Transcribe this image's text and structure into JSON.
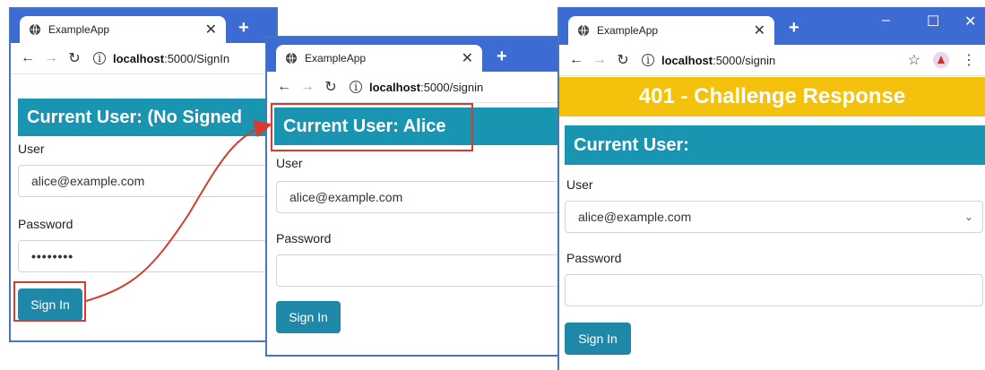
{
  "windows": [
    {
      "tab_title": "ExampleApp",
      "url_host": "localhost",
      "url_rest": ":5000/SignIn",
      "header": "Current User: (No Signed",
      "user_label": "User",
      "user_value": "alice@example.com",
      "password_label": "Password",
      "password_value": "••••••••",
      "sign_in": "Sign In"
    },
    {
      "tab_title": "ExampleApp",
      "url_host": "localhost",
      "url_rest": ":5000/signin",
      "header": "Current User: Alice",
      "user_label": "User",
      "user_value": "alice@example.com",
      "password_label": "Password",
      "password_value": "",
      "sign_in": "Sign In"
    },
    {
      "tab_title": "ExampleApp",
      "url_host": "localhost",
      "url_rest": ":5000/signin",
      "banner": "401 - Challenge Response",
      "header": "Current User:",
      "user_label": "User",
      "user_value": "alice@example.com",
      "password_label": "Password",
      "password_value": "",
      "sign_in": "Sign In"
    }
  ],
  "colors": {
    "tabbar": "#3c6bd4",
    "teal_header": "#1995b1",
    "button": "#1f88a8",
    "banner": "#f4c20d",
    "highlight": "#d63b30"
  }
}
